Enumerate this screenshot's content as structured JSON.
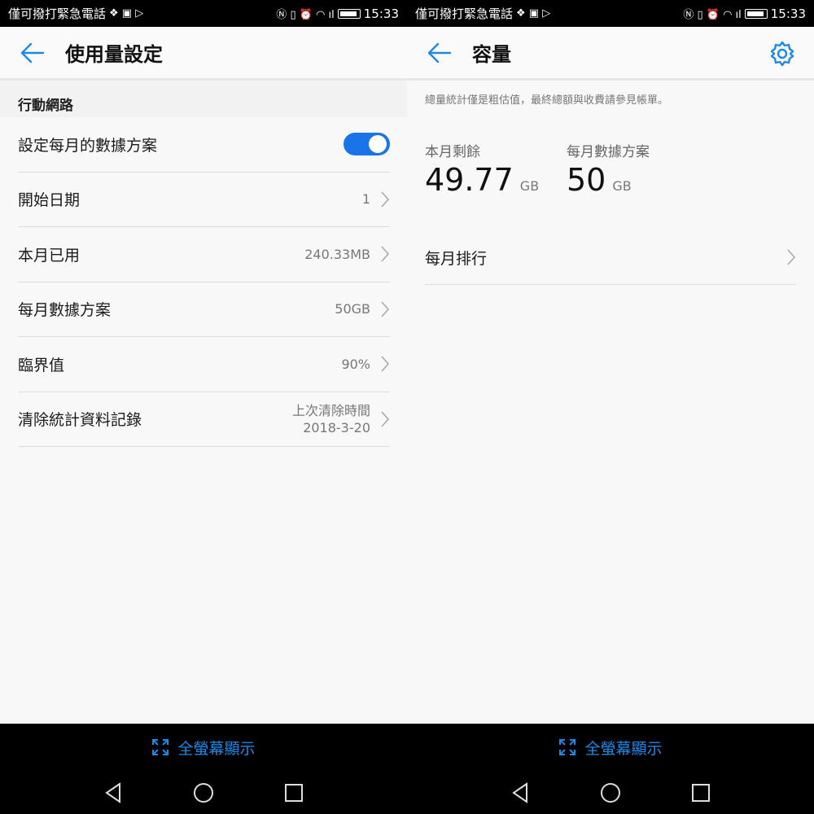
{
  "status_bar": {
    "carrier": "僅可撥打緊急電話",
    "time": "15:33"
  },
  "left_screen": {
    "title": "使用量設定",
    "section_header": "行動網路",
    "rows": [
      {
        "label": "設定每月的數據方案",
        "toggle_on": true
      },
      {
        "label": "開始日期",
        "value": "1"
      },
      {
        "label": "本月已用",
        "value": "240.33MB"
      },
      {
        "label": "每月數據方案",
        "value": "50GB"
      },
      {
        "label": "臨界值",
        "value": "90%"
      },
      {
        "label": "清除統計資料記錄",
        "value_line1": "上次清除時間",
        "value_line2": "2018-3-20"
      }
    ]
  },
  "right_screen": {
    "title": "容量",
    "note": "總量統計僅是粗估值，最終總額與收費請參見帳單。",
    "remaining_label": "本月剩餘",
    "remaining_value": "49.77",
    "remaining_unit": "GB",
    "plan_label": "每月數據方案",
    "plan_value": "50",
    "plan_unit": "GB",
    "rank_label": "每月排行"
  },
  "bottom_bar": {
    "fullscreen_label": "全螢幕顯示"
  },
  "colors": {
    "accent": "#1a73e8",
    "fullscreen_text": "#1e88e5"
  },
  "icons": [
    "back-arrow-icon",
    "gear-icon",
    "chevron-right-icon",
    "fullscreen-icon",
    "nav-back-icon",
    "nav-home-icon",
    "nav-recents-icon"
  ]
}
